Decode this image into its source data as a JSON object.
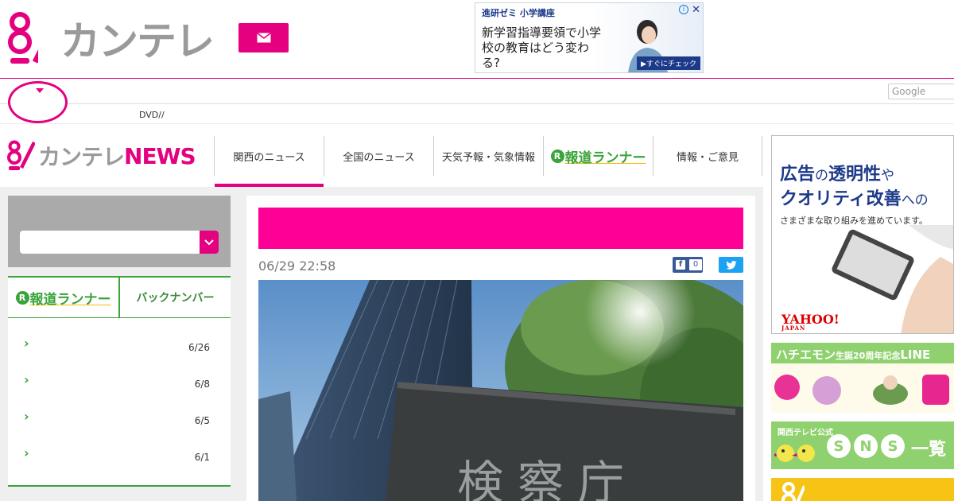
{
  "header": {
    "brand": "カンテレ",
    "ad_top": {
      "title": "進研ゼミ 小学講座",
      "body": "新学習指導要領で小学校の教育はどう変わる?",
      "cta": "▶すぐにチェック"
    }
  },
  "subbar": {
    "google_placeholder": "Google",
    "dvd_link": "DVD//"
  },
  "news_nav": {
    "logo_text": "カンテレ",
    "logo_news": "NEWS",
    "tabs": [
      {
        "label": "関西のニュース",
        "active": true
      },
      {
        "label": "全国のニュース",
        "active": false
      },
      {
        "label": "天気予報・気象情報",
        "active": false
      },
      {
        "label": "報道ランナー",
        "active": false,
        "logo": true
      },
      {
        "label": "情報・ご意見",
        "active": false
      }
    ]
  },
  "left": {
    "runner_logo": "報道ランナー",
    "backnumber": "バックナンバー",
    "items": [
      {
        "date": "6/26"
      },
      {
        "date": "6/8"
      },
      {
        "date": "6/5"
      },
      {
        "date": "6/1"
      }
    ]
  },
  "article": {
    "timestamp": "06/29 22:58",
    "fb_count": "0",
    "sign_text": "検察庁"
  },
  "right": {
    "ad_yahoo": {
      "line1": "広告",
      "line1_s": "の",
      "line1b": "透明性",
      "line1c": "や",
      "line2": "クオリティ改善",
      "line2_s": "への",
      "sub": "さまざまな取り組みを進めています。",
      "logo": "YAHOO!",
      "logo_sub": "JAPAN"
    },
    "ad_hachi": {
      "title": "ハチエモン",
      "title_sm": "生誕20周年記念",
      "title_end": "LINE"
    },
    "ad_sns": {
      "small": "関西テレビ公式",
      "letters": [
        "S",
        "N",
        "S"
      ],
      "suffix": "一覧"
    }
  },
  "colors": {
    "brand_pink": "#e4007f",
    "headline_pink": "#ff0097",
    "runner_green": "#3aa33a",
    "facebook": "#3b5998",
    "twitter": "#1da1f2"
  }
}
